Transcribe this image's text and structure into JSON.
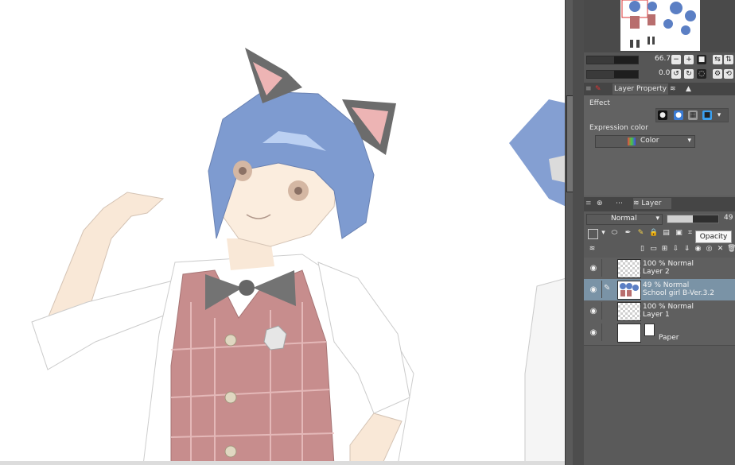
{
  "navigator": {
    "zoom_value": "66.7",
    "rotation_value": "0.0"
  },
  "layer_property": {
    "tab_label": "Layer Property",
    "effect_label": "Effect",
    "expression_color_label": "Expression color",
    "expression_color_value": "Color"
  },
  "layer_panel": {
    "tab_label": "Layer",
    "blend_mode": "Normal",
    "opacity_value": "49",
    "tooltip": "Opacity",
    "layers": [
      {
        "opacity_mode": "100 % Normal",
        "name": "Layer 2",
        "selected": false
      },
      {
        "opacity_mode": "49 % Normal",
        "name": "School girl B-Ver.3.2",
        "selected": true
      },
      {
        "opacity_mode": "100 % Normal",
        "name": "Layer 1",
        "selected": false
      },
      {
        "opacity_mode": "",
        "name": "Paper",
        "selected": false
      }
    ]
  },
  "colors": {
    "panel_bg": "#5e5e5e",
    "selected_layer": "#7a93a6",
    "hair_blue": "#5b7fc4",
    "vest_red": "#b86e6e"
  }
}
